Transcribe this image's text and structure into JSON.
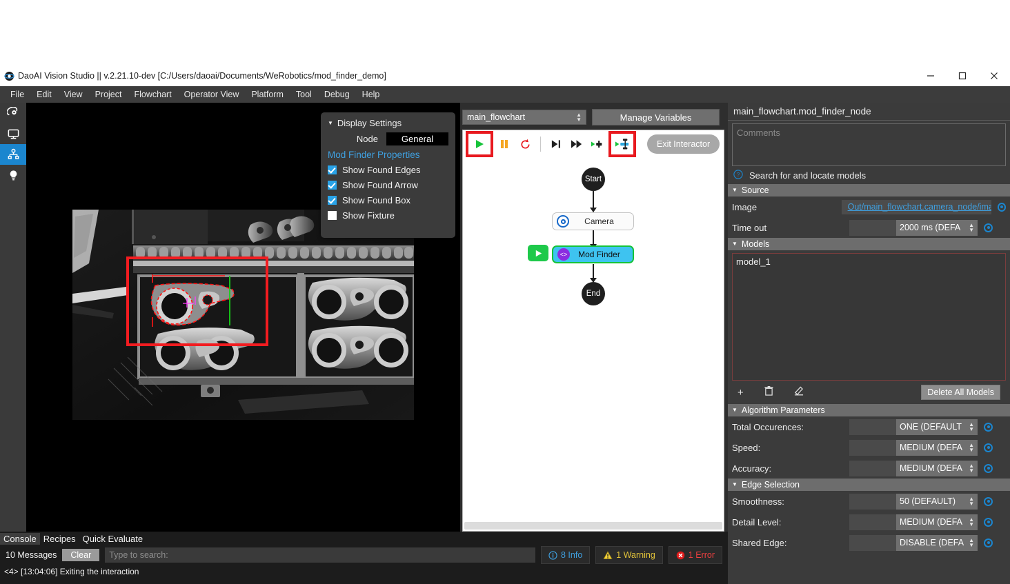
{
  "window": {
    "title": "DaoAI Vision Studio || v.2.21.10-dev   [C:/Users/daoai/Documents/WeRobotics/mod_finder_demo]",
    "minimize": "–",
    "maximize": "□",
    "close": "✕"
  },
  "menubar": [
    "File",
    "Edit",
    "View",
    "Project",
    "Flowchart",
    "Operator View",
    "Platform",
    "Tool",
    "Debug",
    "Help"
  ],
  "rail": [
    {
      "icon": "orbit-eye-icon",
      "selected": false
    },
    {
      "icon": "monitor-icon",
      "selected": false
    },
    {
      "icon": "flowchart-icon",
      "selected": true
    },
    {
      "icon": "lightbulb-icon",
      "selected": false
    }
  ],
  "display_settings": {
    "title": "Display Settings",
    "tab_node": "Node",
    "tab_general": "General",
    "subtitle": "Mod Finder Properties",
    "options": [
      {
        "label": "Show Found Edges",
        "checked": true
      },
      {
        "label": "Show Found Arrow",
        "checked": true
      },
      {
        "label": "Show Found Box",
        "checked": true
      },
      {
        "label": "Show Fixture",
        "checked": false
      }
    ]
  },
  "flowchart": {
    "selector_value": "main_flowchart",
    "manage_variables": "Manage Variables",
    "exit_interactor": "Exit Interactor",
    "toolbar": [
      {
        "name": "run-button",
        "icon": "play-icon",
        "highlighted": true
      },
      {
        "name": "pause-button",
        "icon": "pause-icon",
        "highlighted": false
      },
      {
        "name": "reset-button",
        "icon": "reload-icon",
        "highlighted": false
      },
      {
        "name": "step-button",
        "icon": "step-over-icon",
        "highlighted": false
      },
      {
        "name": "step-fast-button",
        "icon": "skip-forward-icon",
        "highlighted": false
      },
      {
        "name": "run-to-node-button",
        "icon": "run-node-icon",
        "highlighted": false
      },
      {
        "name": "run-selected-node-button",
        "icon": "run-selected-node-icon",
        "highlighted": true
      }
    ],
    "nodes": [
      {
        "id": "start",
        "label": "Start",
        "type": "terminal"
      },
      {
        "id": "camera",
        "label": "Camera",
        "type": "step",
        "selected": false
      },
      {
        "id": "mod_finder",
        "label": "Mod Finder",
        "type": "step",
        "selected": true,
        "has_run_badge": true
      },
      {
        "id": "end",
        "label": "End",
        "type": "terminal"
      }
    ]
  },
  "properties": {
    "title": "main_flowchart.mod_finder_node",
    "comments_placeholder": "Comments",
    "help_text": "Search for and locate models",
    "sections": {
      "source": {
        "title": "Source",
        "rows": [
          {
            "label": "Image",
            "kind": "link",
            "value": "Out/main_flowchart.camera_node/ima"
          },
          {
            "label": "Time out",
            "kind": "combo",
            "value": "2000 ms (DEFA"
          }
        ]
      },
      "models": {
        "title": "Models",
        "items": [
          "model_1"
        ],
        "add_label": "+",
        "delete_label": "🗑",
        "edit_label": "✎",
        "delete_all_label": "Delete All Models"
      },
      "algorithm_parameters": {
        "title": "Algorithm Parameters",
        "rows": [
          {
            "label": "Total Occurences:",
            "value": "ONE (DEFAULT"
          },
          {
            "label": "Speed:",
            "value": "MEDIUM (DEFA"
          },
          {
            "label": "Accuracy:",
            "value": "MEDIUM (DEFA"
          }
        ]
      },
      "edge_selection": {
        "title": "Edge Selection",
        "rows": [
          {
            "label": "Smoothness:",
            "value": "50 (DEFAULT)"
          },
          {
            "label": "Detail Level:",
            "value": "MEDIUM (DEFA"
          },
          {
            "label": "Shared Edge:",
            "value": "DISABLE (DEFA"
          }
        ]
      }
    }
  },
  "console": {
    "tabs": [
      {
        "label": "Console",
        "active": true
      },
      {
        "label": "Recipes",
        "active": false
      },
      {
        "label": "Quick Evaluate",
        "active": false
      }
    ],
    "message_count": "10 Messages",
    "clear_label": "Clear",
    "search_placeholder": "Type to search:",
    "info_label": "8 Info",
    "warning_label": "1 Warning",
    "error_label": "1 Error",
    "log_line": "<4> [13:04:06] Exiting the interaction"
  },
  "colors": {
    "accent_blue": "#1b86cf",
    "highlight_red": "#e8191f",
    "node_selected": "#3ec3f0",
    "node_selected_border": "#16c33a",
    "run_green": "#1ec94a",
    "link_blue": "#3fa0e0"
  }
}
